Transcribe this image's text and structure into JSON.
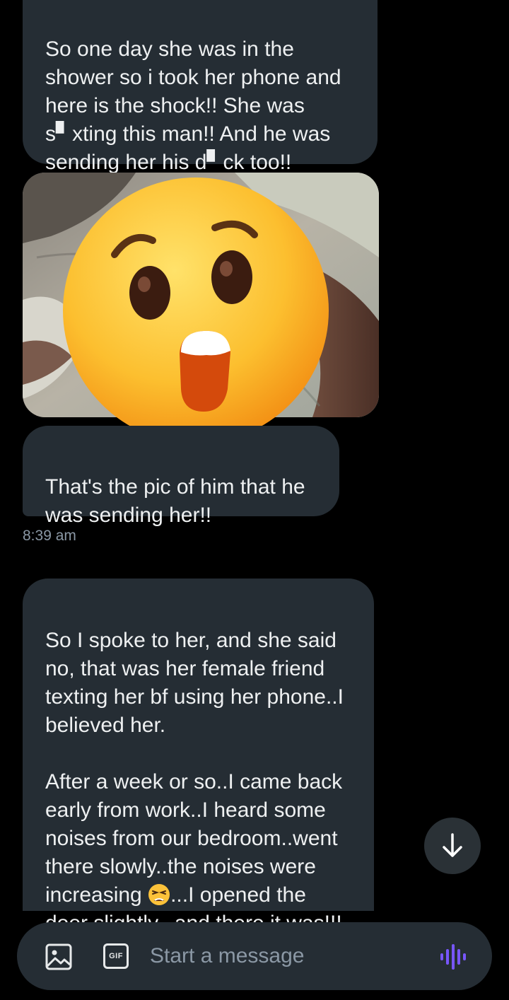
{
  "thread": {
    "messages": [
      {
        "text": "So one day she was in the\nshower so i took her phone and\nhere is the shock!! She was\ns▘xting this man!! And he was\nsending her his d▘ck too!!"
      },
      {
        "text": "That's the pic of him that he\nwas sending her!!"
      }
    ],
    "timestamp": "8:39 am",
    "long_message": {
      "para1": "So I spoke to her, and she said\nno, that was her female friend\ntexting her bf using her phone..I\nbelieved her.",
      "para2_before_emoji": "After a week or so..I came back\nearly from work..I heard some\nnoises from our bedroom..went\nthere slowly..the noises were\nincreasing ",
      "para2_after_emoji": "...I opened the\ndoor slightly...and there it was!!!"
    }
  },
  "composer": {
    "placeholder": "Start a message",
    "gif_label": "GIF",
    "image_icon": "image-icon",
    "voice_icon": "voice-waveform-icon"
  },
  "icons": {
    "scroll": "arrow-down-icon",
    "sticker": "astonished-face-emoji",
    "inline": "tired-face-emoji"
  },
  "colors": {
    "background": "#000000",
    "bubble": "#252d34",
    "text": "#eef0f1",
    "muted": "#8b98a5",
    "accent": "#7856ff"
  }
}
